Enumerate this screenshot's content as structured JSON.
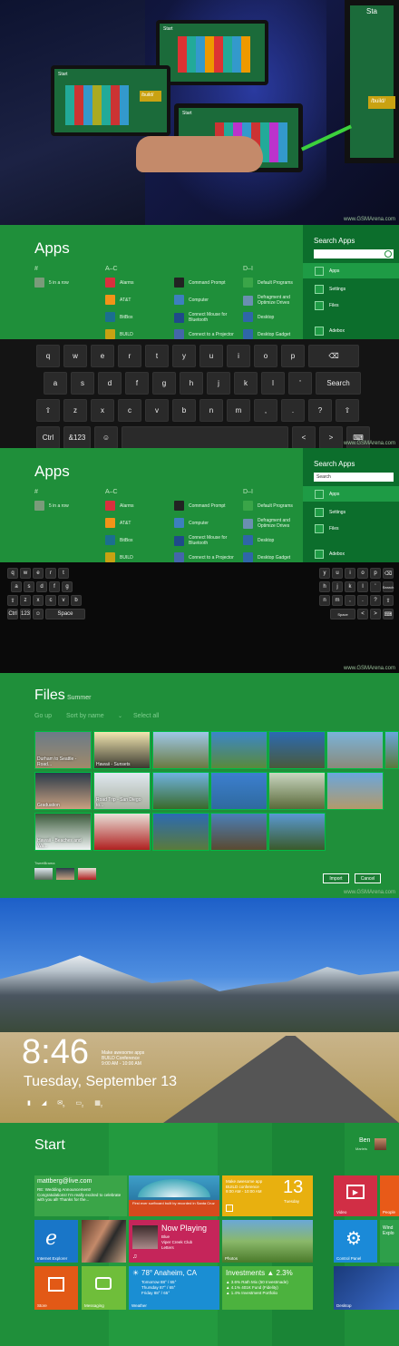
{
  "watermark": "www.GSMArena.com",
  "photo_top": {
    "label_start": "Start",
    "build_label": "/build/",
    "tablet_corner_label": "Sta"
  },
  "apps_keyboard_screen": {
    "title": "Apps",
    "groups": [
      "#",
      "A–C",
      "D–I"
    ],
    "apps": [
      {
        "group": 0,
        "name": "5 in a row",
        "color": "#7a9b7a"
      },
      {
        "group": 1,
        "name": "Alarms",
        "color": "#d9303d"
      },
      {
        "group": 1,
        "name": "AT&T",
        "color": "#f39318"
      },
      {
        "group": 1,
        "name": "BitBox",
        "color": "#1b6f8f"
      },
      {
        "group": 1,
        "name": "BUILD",
        "color": "#c8a212"
      },
      {
        "group": 2,
        "name": "Command Prompt",
        "color": "#222222"
      },
      {
        "group": 2,
        "name": "Computer",
        "color": "#3d7fbf"
      },
      {
        "group": 2,
        "name": "Connect Mouse for Bluetooth",
        "color": "#1f4a8a"
      },
      {
        "group": 2,
        "name": "Connect to a Projector",
        "color": "#4466aa"
      },
      {
        "group": 3,
        "name": "Default Programs",
        "color": "#3aa548"
      },
      {
        "group": 3,
        "name": "Defragment and Optimize Drives",
        "color": "#6a8fb0"
      },
      {
        "group": 3,
        "name": "Desktop",
        "color": "#2f66a8"
      },
      {
        "group": 3,
        "name": "Desktop Gadget",
        "color": "#2f66a8"
      }
    ],
    "search": {
      "title": "Search Apps",
      "value": "",
      "items": [
        "Apps",
        "Settings",
        "Files",
        "Adebox"
      ]
    }
  },
  "keyboard_full": {
    "rows": [
      [
        "q",
        "w",
        "e",
        "r",
        "t",
        "y",
        "u",
        "i",
        "o",
        "p",
        "⌫"
      ],
      [
        "a",
        "s",
        "d",
        "f",
        "g",
        "h",
        "j",
        "k",
        "l",
        "'",
        "Search"
      ],
      [
        "⇧",
        "z",
        "x",
        "c",
        "v",
        "b",
        "n",
        "m",
        ",",
        ".",
        "?",
        "⇧"
      ],
      [
        "Ctrl",
        "&123",
        "☺",
        "",
        "<",
        ">",
        "⌨"
      ]
    ]
  },
  "apps_split_screen": {
    "title": "Apps",
    "search": {
      "title": "Search Apps",
      "value": "Search",
      "items": [
        "Apps",
        "Settings",
        "Files",
        "Adebox"
      ]
    },
    "left_keys": [
      [
        "q",
        "w",
        "e",
        "r",
        "t"
      ],
      [
        "a",
        "s",
        "d",
        "f",
        "g"
      ],
      [
        "⇧",
        "z",
        "x",
        "c",
        "v",
        "b"
      ],
      [
        "Ctrl",
        "123",
        "☺",
        "Space"
      ]
    ],
    "right_keys": [
      [
        "y",
        "u",
        "i",
        "o",
        "p",
        "⌫"
      ],
      [
        "h",
        "j",
        "k",
        "l",
        "'",
        "Search"
      ],
      [
        "n",
        "m",
        ",",
        ".",
        "?",
        "⇧"
      ],
      [
        "Space",
        "<",
        ">",
        "⌨"
      ]
    ]
  },
  "files_screen": {
    "title": "Files",
    "subtitle": "Summer",
    "commands": [
      "Go up",
      "Sort by name",
      "Select all"
    ],
    "photos": [
      {
        "caption": "Durham to Seattle - Road...",
        "c1": "#6b7b88",
        "c2": "#a08a6a"
      },
      {
        "caption": "Hawaii - Sunsets",
        "c1": "#f2e6b0",
        "c2": "#3b3a30"
      },
      {
        "caption": "",
        "c1": "#9ec7e8",
        "c2": "#6a7a40"
      },
      {
        "caption": "",
        "c1": "#3b86c9",
        "c2": "#5a8a3a"
      },
      {
        "caption": "",
        "c1": "#2b6ab3",
        "c2": "#4a5a3a"
      },
      {
        "caption": "",
        "c1": "#7ab3d9",
        "c2": "#8a8a7a"
      },
      {
        "caption": "Graduation",
        "c1": "#2a3b4a",
        "c2": "#c9a080"
      },
      {
        "caption": "Road Trip - San Diego to...",
        "c1": "#dfe8f0",
        "c2": "#aab0a0"
      },
      {
        "caption": "",
        "c1": "#6fb2e0",
        "c2": "#3a6a2a"
      },
      {
        "caption": "",
        "c1": "#3c7fcf",
        "c2": "#2f6a9f"
      },
      {
        "caption": "",
        "c1": "#c9d6c0",
        "c2": "#5a6a3a"
      },
      {
        "caption": "",
        "c1": "#6aa6dc",
        "c2": "#b39a6a"
      },
      {
        "caption": "Hawaii - Beaches and Wa...",
        "c1": "#3a5a3a",
        "c2": "#f0f4f4"
      },
      {
        "caption": "",
        "c1": "#e8e0d8",
        "c2": "#b02020"
      },
      {
        "caption": "",
        "c1": "#2c6ab3",
        "c2": "#5a7a3a"
      },
      {
        "caption": "",
        "c1": "#4a7fb8",
        "c2": "#5a4a30"
      },
      {
        "caption": "",
        "c1": "#5a99d3",
        "c2": "#3a5a2a"
      }
    ],
    "basket_label": "TweetBrama",
    "import_label": "Import",
    "cancel_label": "Cancel"
  },
  "lock_screen": {
    "time": "8:46",
    "date": "Tuesday, September 13",
    "notification": "Make awesome apps\nBUILD Conference\n9:00 AM - 10:00 AM",
    "badges": [
      "5",
      "2",
      "2"
    ]
  },
  "start_screen": {
    "title": "Start",
    "user_first": "Ben",
    "user_last": "Marleis",
    "tiles": {
      "mail_from": "mattberg@live.com",
      "mail_subject": "RE: Wedding Announcement!",
      "mail_body": "Congratulations! I'm really excited to celebrate with you all! Thanks for the...",
      "surf_caption": "First ever surfboard built by recorded in Santa Cruz",
      "calendar_text": "Make awesome app\nBUILD conference\n9:00 AM - 10:00 AM",
      "calendar_day": "13",
      "calendar_weekday": "Tuesday",
      "video_label": "Video",
      "people_label": "People",
      "ie_label": "Internet Explorer",
      "now_playing_title": "Now Playing",
      "now_playing_artist": "Blue",
      "now_playing_album": "Viper Creek Club",
      "now_playing_track": "Letters",
      "photos_label": "Photos",
      "control_panel_label": "Control Panel",
      "wind_label": "Wind Explo",
      "store_label": "Store",
      "messaging_label": "Messaging",
      "weather_title": "78° Anaheim, CA",
      "weather_today": "Tomorrow 88° / 65°",
      "weather_thursday": "Thursday 87° / 65°",
      "weather_friday": "Friday 88° / 65°",
      "weather_label": "Weather",
      "investments_title": "Investments ▲ 2.3%",
      "investments_rows": [
        "▲ 3.6%  Rath Mix (50 Investmade)",
        "▲ 4.1%  401K Fund (Fidelity)",
        "▲ 1.4%  Investment Portfolio"
      ],
      "desktop_label": "Desktop"
    },
    "colors": {
      "mail": "#3aa548",
      "surf": "#d64a1d",
      "calendar": "#e8b00f",
      "video": "#d12e45",
      "people": "#e85a18",
      "ie": "#1976c8",
      "music": "#c5255a",
      "control": "#1b8ad8",
      "store": "#e25916",
      "messaging": "#6fbe3a",
      "weather": "#1a8ed3",
      "invest": "#4cb23e",
      "desktop": "#2a4a8a"
    }
  }
}
